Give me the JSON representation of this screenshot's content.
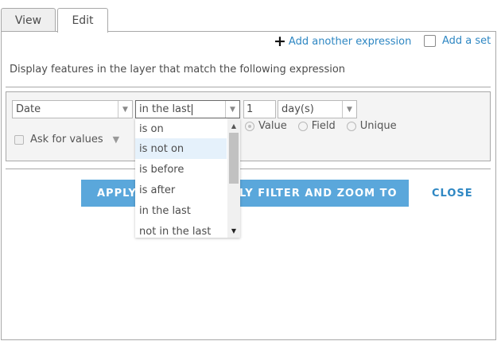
{
  "tabs": [
    {
      "label": "View",
      "active": false
    },
    {
      "label": "Edit",
      "active": true
    }
  ],
  "actions": {
    "add_expression": "Add another expression",
    "add_set": "Add a set"
  },
  "description": "Display features in the layer that match the following expression",
  "expression": {
    "field": "Date",
    "operator": "in the last",
    "number": "1",
    "unit": "day(s)",
    "ask_for_values": "Ask for values",
    "value_types": [
      {
        "label": "Value",
        "selected": true
      },
      {
        "label": "Field",
        "selected": false
      },
      {
        "label": "Unique",
        "selected": false
      }
    ]
  },
  "operator_options": [
    "is on",
    "is not on",
    "is before",
    "is after",
    "in the last",
    "not in the last"
  ],
  "highlighted_option": "is not on",
  "buttons": {
    "apply": "APPLY",
    "apply_zoom": "LY FILTER AND ZOOM TO",
    "close": "CLOSE"
  },
  "colors": {
    "accent": "#5aa7db",
    "link": "#2e87c3",
    "highlight": "#e5f1fb"
  }
}
